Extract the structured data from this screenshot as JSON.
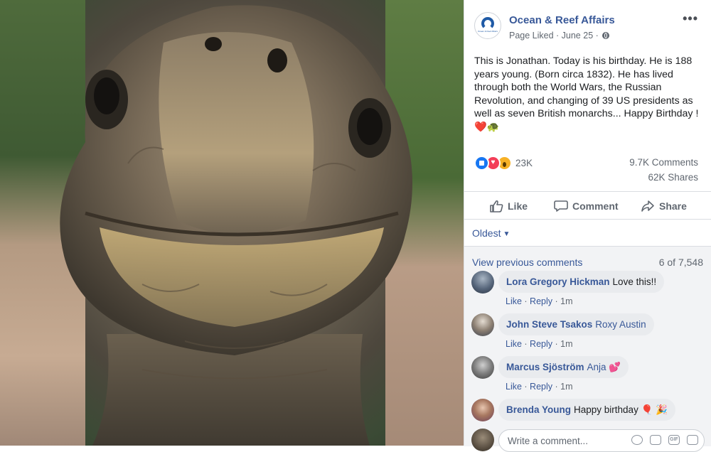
{
  "post": {
    "page_name": "Ocean & Reef Affairs",
    "meta": "Page Liked · June 25 · ",
    "more": "•••",
    "avatar_caption": "Ocean & Reef Affairs",
    "text": "This is Jonathan. Today is his birthday. He is 188 years young. (Born circa 1832). He has lived through both the World Wars, the Russian Revolution, and changing of 39 US presidents as well as seven British monarchs... Happy Birthday ! ",
    "text_emoji": "❤️🐢"
  },
  "stats": {
    "reactions": "23K",
    "comments": "9.7K Comments",
    "shares": "62K Shares"
  },
  "actions": {
    "like": "Like",
    "comment": "Comment",
    "share": "Share"
  },
  "sort": {
    "label": "Oldest"
  },
  "comments_section": {
    "view_previous": "View previous comments",
    "count": "6 of 7,548",
    "items": [
      {
        "name": "Lora Gregory Hickman",
        "text": "Love this!!",
        "tag": "",
        "like": "Like",
        "reply": "Reply",
        "time": "1m"
      },
      {
        "name": "John Steve Tsakos",
        "text": "",
        "tag": "Roxy Austin",
        "like": "Like",
        "reply": "Reply",
        "time": "1m"
      },
      {
        "name": "Marcus Sjöström",
        "text": "",
        "tag": "Anja 💕",
        "like": "Like",
        "reply": "Reply",
        "time": "1m"
      },
      {
        "name": "Brenda Young",
        "text": "Happy birthday 🎈 🎉",
        "tag": "",
        "like": "Like",
        "reply": "Reply",
        "time": "1m"
      }
    ]
  },
  "composer": {
    "placeholder": "Write a comment..."
  },
  "icons": [
    "page-avatar-icon",
    "globe-icon",
    "more-icon",
    "like-reaction-icon",
    "love-reaction-icon",
    "wow-reaction-icon",
    "thumbs-up-icon",
    "comment-bubble-icon",
    "share-arrow-icon",
    "emoji-icon",
    "camera-icon",
    "gif-icon",
    "sticker-icon"
  ],
  "colors": {
    "link": "#385898",
    "like_blue": "#1877f2",
    "love_red": "#f33e58",
    "wow_yellow": "#f7b125"
  }
}
